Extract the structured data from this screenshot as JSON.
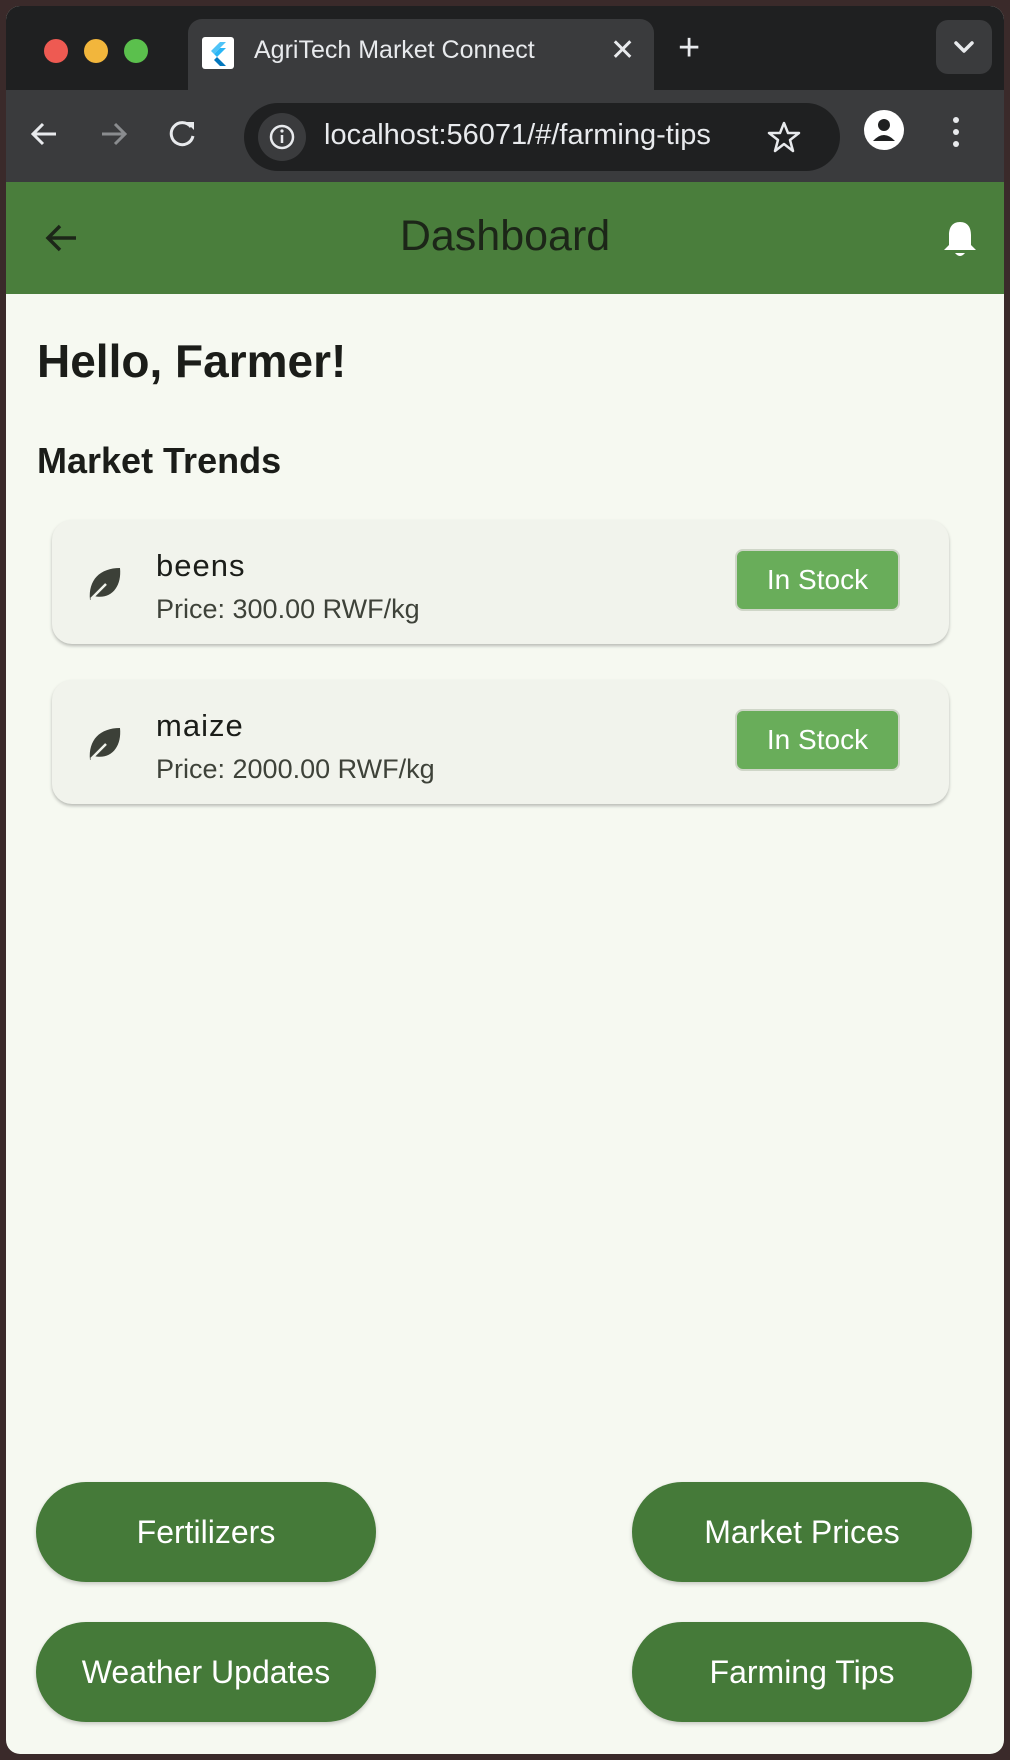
{
  "browser": {
    "tab_title": "AgriTech Market Connect",
    "url": "localhost:56071/#/farming-tips"
  },
  "appbar": {
    "title": "Dashboard"
  },
  "main": {
    "greeting": "Hello, Farmer!",
    "section_title": "Market Trends",
    "items": [
      {
        "name": "beens",
        "price": "Price: 300.00 RWF/kg",
        "status": "In Stock"
      },
      {
        "name": "maize",
        "price": "Price: 2000.00 RWF/kg",
        "status": "In Stock"
      }
    ]
  },
  "actions": {
    "fertilizers": "Fertilizers",
    "market_prices": "Market Prices",
    "weather_updates": "Weather Updates",
    "farming_tips": "Farming Tips"
  },
  "colors": {
    "app_bar": "#4a7e3c",
    "background": "#f6f9f1",
    "stock_chip": "#69ad5a",
    "action_button": "#457a39"
  },
  "icons": [
    "back-arrow-icon",
    "bell-icon",
    "leaf-icon",
    "star-icon",
    "info-icon",
    "reload-icon",
    "profile-icon",
    "kebab-menu-icon"
  ]
}
